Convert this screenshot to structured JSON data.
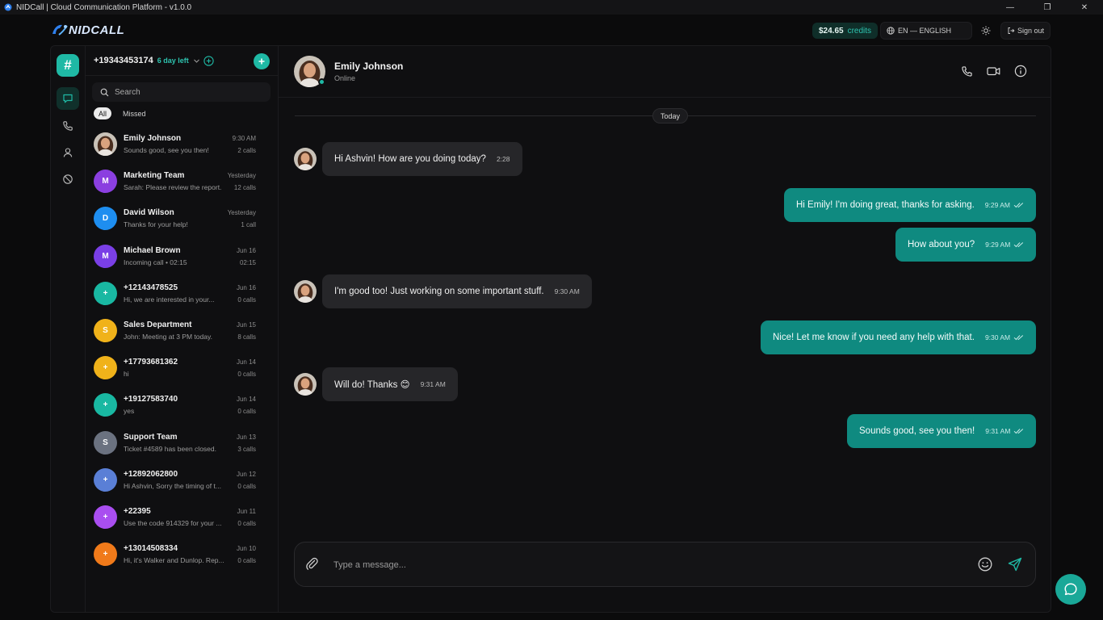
{
  "window": {
    "title": "NIDCall | Cloud Communication Platform  -  v1.0.0",
    "minimize": "—",
    "maximize": "❐",
    "close": "✕"
  },
  "topbar": {
    "logo_text": "NIDCALL",
    "credits_amount": "$24.65",
    "credits_label": "credits",
    "language": "EN — ENGLISH",
    "signout_label": "Sign out"
  },
  "rail": {
    "brand_glyph": "#",
    "active_item": "messages"
  },
  "account": {
    "number": "+19343453174",
    "days_left": "6 day left"
  },
  "search": {
    "placeholder": "Search"
  },
  "filters": [
    "All",
    "Missed"
  ],
  "conversations": [
    {
      "name": "Emily Johnson",
      "preview": "Sounds good, see you then!",
      "time": "9:30 AM",
      "count": "2 calls",
      "initial": "",
      "color": "#8a6a55",
      "photo": true
    },
    {
      "name": "Marketing Team",
      "preview": "Sarah: Please review the report.",
      "time": "Yesterday",
      "count": "12 calls",
      "initial": "M",
      "color": "#8b3fe0"
    },
    {
      "name": "David Wilson",
      "preview": "Thanks for your help!",
      "time": "Yesterday",
      "count": "1 call",
      "initial": "D",
      "color": "#1e8ef0"
    },
    {
      "name": "Michael Brown",
      "preview": "Incoming call • 02:15",
      "time": "Jun 16",
      "count": "02:15",
      "initial": "M",
      "color": "#7a3fe6"
    },
    {
      "name": "+12143478525",
      "preview": "Hi, we are interested in your...",
      "time": "Jun 16",
      "count": "0 calls",
      "initial": "+",
      "color": "#19b8a2"
    },
    {
      "name": "Sales Department",
      "preview": "John: Meeting at 3 PM today.",
      "time": "Jun 15",
      "count": "8 calls",
      "initial": "S",
      "color": "#f0b21a"
    },
    {
      "name": "+17793681362",
      "preview": "hi",
      "time": "Jun 14",
      "count": "0 calls",
      "initial": "+",
      "color": "#f0b21a"
    },
    {
      "name": "+19127583740",
      "preview": "yes",
      "time": "Jun 14",
      "count": "0 calls",
      "initial": "+",
      "color": "#19b8a2"
    },
    {
      "name": "Support Team",
      "preview": "Ticket #4589 has been closed.",
      "time": "Jun 13",
      "count": "3 calls",
      "initial": "S",
      "color": "#6b7280"
    },
    {
      "name": "+12892062800",
      "preview": "Hi Ashvin, Sorry the timing of t...",
      "time": "Jun 12",
      "count": "0 calls",
      "initial": "+",
      "color": "#5a7fd6"
    },
    {
      "name": "+22395",
      "preview": "Use the code 914329 for your ...",
      "time": "Jun 11",
      "count": "0 calls",
      "initial": "+",
      "color": "#a94ef0"
    },
    {
      "name": "+13014508334",
      "preview": "Hi, it's Walker and Dunlop. Rep...",
      "time": "Jun 10",
      "count": "0 calls",
      "initial": "+",
      "color": "#f07a1a"
    }
  ],
  "chat": {
    "contact_name": "Emily Johnson",
    "status": "Online",
    "date_label": "Today",
    "messages": [
      {
        "dir": "in",
        "text": "Hi Ashvin! How are you doing today?",
        "time": "2:28"
      },
      {
        "dir": "out",
        "text": "Hi Emily! I'm doing great, thanks for asking.",
        "time": "9:29 AM"
      },
      {
        "dir": "out",
        "text": "How about you?",
        "time": "9:29 AM"
      },
      {
        "dir": "in",
        "text": "I'm good too! Just working on some important stuff.",
        "time": "9:30 AM"
      },
      {
        "dir": "out",
        "text": "Nice! Let me know if you need any help with that.",
        "time": "9:30 AM"
      },
      {
        "dir": "in",
        "text": "Will do! Thanks 😊",
        "time": "9:31 AM"
      },
      {
        "dir": "out",
        "text": "Sounds good, see you then!",
        "time": "9:31 AM"
      }
    ]
  },
  "composer": {
    "placeholder": "Type a message..."
  },
  "colors": {
    "accent": "#1fb9a5",
    "outgoing_bubble": "#0f8a80",
    "incoming_bubble": "#262629",
    "background": "#0b0b0c"
  }
}
